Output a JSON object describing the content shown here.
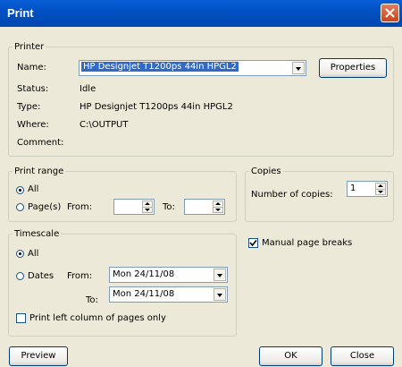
{
  "window": {
    "title": "Print"
  },
  "printer": {
    "legend": "Printer",
    "name_label": "Name:",
    "name_value": "HP Designjet T1200ps 44in HPGL2",
    "properties_label": "Properties",
    "status_label": "Status:",
    "status_value": "Idle",
    "type_label": "Type:",
    "type_value": "HP Designjet T1200ps 44in HPGL2",
    "where_label": "Where:",
    "where_value": "C:\\OUTPUT",
    "comment_label": "Comment:",
    "comment_value": ""
  },
  "print_range": {
    "legend": "Print range",
    "all_label": "All",
    "pages_label": "Page(s)",
    "from_label": "From:",
    "to_label": "To:",
    "from_value": "",
    "to_value": "",
    "selected": "all"
  },
  "copies": {
    "legend": "Copies",
    "number_label": "Number of copies:",
    "number_value": "1"
  },
  "timescale": {
    "legend": "Timescale",
    "all_label": "All",
    "dates_label": "Dates",
    "from_label": "From:",
    "to_label": "To:",
    "from_value": "Mon 24/11/08",
    "to_value": "Mon 24/11/08",
    "left_column_label": "Print left column of pages only",
    "left_column_checked": false,
    "selected": "all"
  },
  "manual_page_breaks": {
    "label": "Manual page breaks",
    "checked": true
  },
  "buttons": {
    "preview": "Preview",
    "ok": "OK",
    "close": "Close"
  },
  "colors": {
    "titlebar": "#0054e3",
    "dialog_bg": "#ece9d8",
    "selection": "#316ac5",
    "close_button": "#d4532d"
  }
}
